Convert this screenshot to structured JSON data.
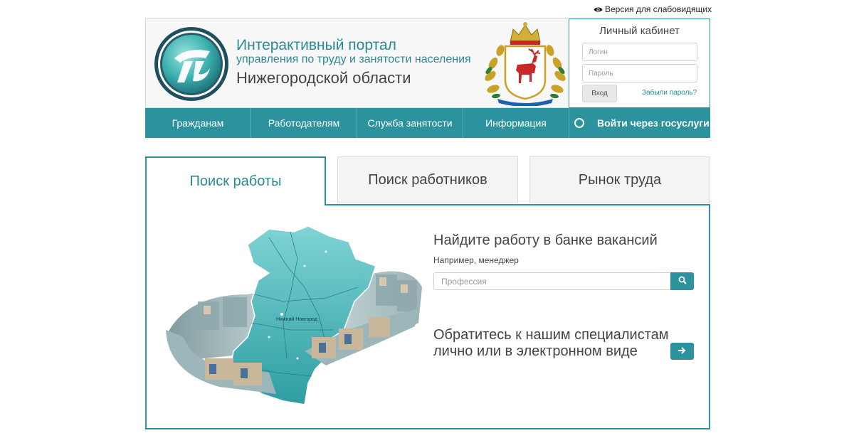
{
  "colors": {
    "accent": "#2c939e",
    "title_accent": "#2a8a96",
    "text": "#444444"
  },
  "accessibility": {
    "label": "Версия для слабовидящих",
    "icon": "eye-icon"
  },
  "header": {
    "title_line1": "Интерактивный портал",
    "title_line2": "управления по труду и занятости населения",
    "title_line3": "Нижегородской области"
  },
  "login": {
    "title": "Личный кабинет",
    "login_placeholder": "Логин",
    "password_placeholder": "Пароль",
    "submit_label": "Вход",
    "forgot_label": "Забыли пароль?"
  },
  "nav": {
    "items": [
      {
        "label": "Гражданам"
      },
      {
        "label": "Работодателям"
      },
      {
        "label": "Служба занятости"
      },
      {
        "label": "Информация"
      }
    ],
    "gosuslugi_label": "Войти через госуслуги"
  },
  "tabs": [
    {
      "label": "Поиск работы",
      "active": true
    },
    {
      "label": "Поиск работников",
      "active": false
    },
    {
      "label": "Рынок труда",
      "active": false
    }
  ],
  "search": {
    "title": "Найдите работу в банке вакансий",
    "hint": "Например, менеджер",
    "placeholder": "Профессия",
    "button_icon": "search-icon"
  },
  "contact": {
    "line1": "Обратитесь к нашим специалистам",
    "line2": "лично или в электронном виде",
    "button_icon": "arrow-right-icon"
  },
  "map": {
    "label": "Нижний Новгород"
  }
}
